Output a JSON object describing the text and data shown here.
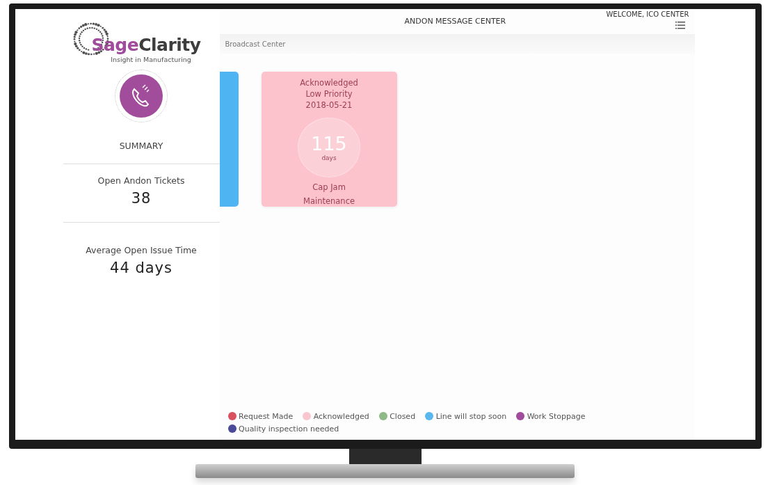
{
  "header": {
    "title": "ANDON MESSAGE CENTER",
    "welcome": "WELCOME, ICO CENTER"
  },
  "sidebar": {
    "logo": {
      "primary": "Sage",
      "secondary": "Clarity",
      "tagline": "Insight in Manufacturing"
    },
    "section": "SUMMARY",
    "stats": [
      {
        "label": "Open Andon Tickets",
        "value": "38"
      },
      {
        "label": "Average Open Issue Time",
        "value": "44 days"
      }
    ]
  },
  "breadcrumb": "Broadcast Center",
  "tickets": [
    {
      "kind": "partial",
      "color": "#4fb5f2"
    },
    {
      "kind": "full",
      "color": "#fcc3cc",
      "status": "Acknowledged",
      "priority": "Low Priority",
      "date": "2018-05-21",
      "count": "115",
      "unit": "days",
      "title": "Cap Jam",
      "subtitle": "Maintenance"
    }
  ],
  "legend": [
    {
      "label": "Request Made",
      "color": "#d9505f"
    },
    {
      "label": "Acknowledged",
      "color": "#f9c6d0"
    },
    {
      "label": "Closed",
      "color": "#8fb986"
    },
    {
      "label": "Line will stop soon",
      "color": "#5ab8ef"
    },
    {
      "label": "Work Stoppage",
      "color": "#a04b9c"
    },
    {
      "label": "Quality inspection needed",
      "color": "#4a4a9a"
    }
  ]
}
